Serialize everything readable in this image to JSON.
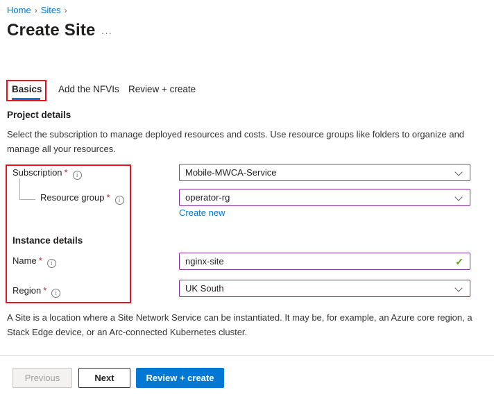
{
  "breadcrumb": {
    "separator": "›",
    "items": [
      {
        "label": "Home"
      },
      {
        "label": "Sites"
      }
    ]
  },
  "header": {
    "title": "Create Site",
    "more_label": "···"
  },
  "tabs": [
    {
      "label": "Basics",
      "active": true
    },
    {
      "label": "Add the NFVIs",
      "active": false
    },
    {
      "label": "Review + create",
      "active": false
    }
  ],
  "project_details": {
    "heading": "Project details",
    "description": "Select the subscription to manage deployed resources and costs. Use resource groups like folders to organize and manage all your resources."
  },
  "form": {
    "subscription": {
      "label": "Subscription",
      "required": "*",
      "value": "Mobile-MWCA-Service"
    },
    "resource_group": {
      "label": "Resource group",
      "required": "*",
      "value": "operator-rg",
      "create_new_label": "Create new"
    },
    "instance_details_heading": "Instance details",
    "name": {
      "label": "Name",
      "required": "*",
      "value": "nginx-site"
    },
    "region": {
      "label": "Region",
      "required": "*",
      "value": "UK South"
    }
  },
  "info_text": "A Site is a location where a Site Network Service can be instantiated. It may be, for example, an Azure core region, a Stack Edge device, or an Arc-connected Kubernetes cluster.",
  "footer": {
    "previous_label": "Previous",
    "next_label": "Next",
    "review_create_label": "Review + create"
  },
  "icons": {
    "info_glyph": "i",
    "checkmark_glyph": "✓"
  },
  "colors": {
    "link_blue": "#0078d4",
    "primary_button_blue": "#0078d4",
    "active_tab_underline": "#0078d4",
    "annotation_red": "#e81123",
    "required_asterisk_red": "#a4262c",
    "modified_field_purple": "#8a2da5",
    "valid_green": "#57a300"
  }
}
